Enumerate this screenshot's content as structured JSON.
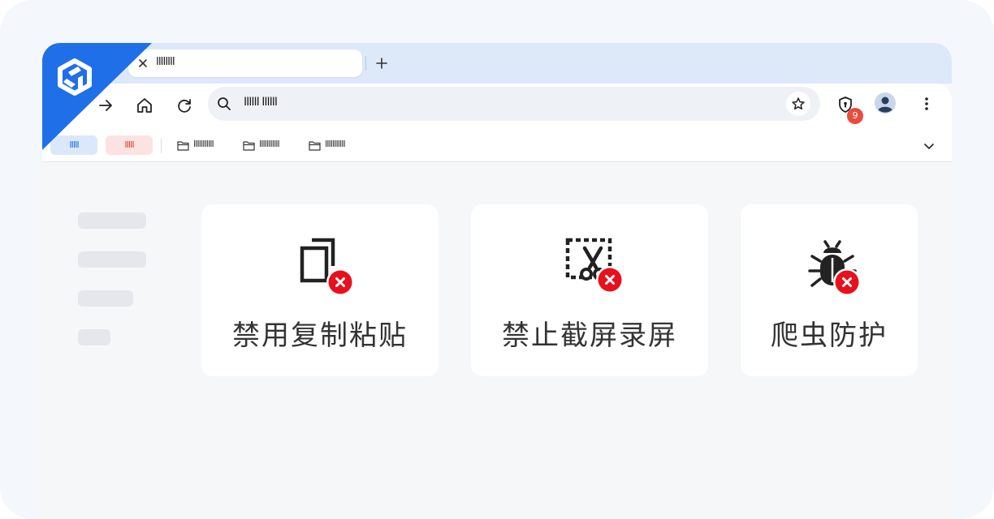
{
  "browser": {
    "tab": {
      "title": "IIIIIIII"
    },
    "address_bar": {
      "url_text": "IIIIII IIIIII"
    },
    "badge_count": "9",
    "bookmarks": {
      "chip_primary": "IIIII",
      "chip_alert": "IIIII",
      "folders": [
        "IIIIIIIIIII",
        "IIIIIIIIIII",
        "IIIIIIIIIII"
      ]
    }
  },
  "features": [
    {
      "label": "禁用复制粘贴",
      "icon": "copy-blocked-icon"
    },
    {
      "label": "禁止截屏录屏",
      "icon": "screenshot-blocked-icon"
    },
    {
      "label": "爬虫防护",
      "icon": "bug-blocked-icon"
    }
  ],
  "colors": {
    "brand_blue": "#1f6fe8",
    "alert_red": "#e8101c",
    "tabstrip": "#dde8f8",
    "badge_red": "#e84d3d"
  }
}
